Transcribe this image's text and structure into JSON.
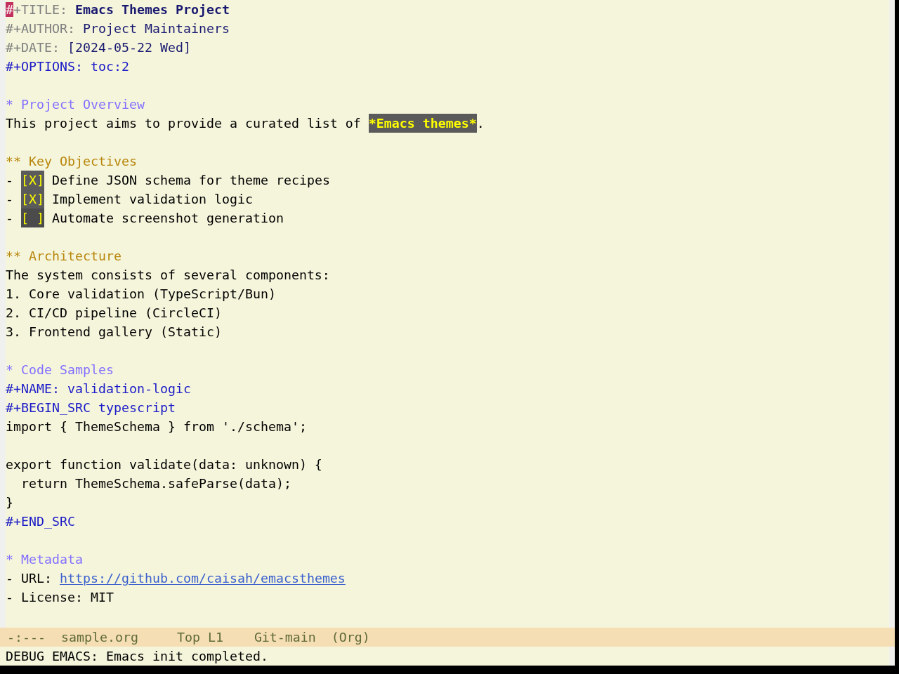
{
  "buffer": {
    "blocks": [
      {
        "lines": [
          {
            "segments": [
              {
                "kind": "cursor",
                "text": "#"
              },
              {
                "kind": "meta",
                "text": "+TITLE: "
              },
              {
                "kind": "title",
                "text": "Emacs Themes Project"
              }
            ]
          },
          {
            "segments": [
              {
                "kind": "meta",
                "text": "#+AUTHOR: "
              },
              {
                "kind": "info",
                "text": "Project Maintainers"
              }
            ]
          },
          {
            "segments": [
              {
                "kind": "meta",
                "text": "#+DATE: "
              },
              {
                "kind": "info",
                "text": "[2024-05-22 Wed]"
              }
            ]
          },
          {
            "segments": [
              {
                "kind": "keyword",
                "text": "#+OPTIONS: toc:2"
              }
            ]
          }
        ]
      },
      {
        "lines": [
          {
            "segments": [
              {
                "kind": "outline1",
                "text": "* Project Overview"
              }
            ]
          },
          {
            "segments": [
              {
                "kind": "plain",
                "text": "This project aims to provide a curated list of "
              },
              {
                "kind": "bold",
                "text": "*Emacs themes*"
              },
              {
                "kind": "plain",
                "text": "."
              }
            ]
          }
        ]
      },
      {
        "lines": [
          {
            "segments": [
              {
                "kind": "outline2",
                "text": "** Key Objectives"
              }
            ]
          },
          {
            "segments": [
              {
                "kind": "plain",
                "text": "- "
              },
              {
                "kind": "checkbox",
                "text": "[X]",
                "checked": true
              },
              {
                "kind": "plain",
                "text": " Define JSON schema for theme recipes"
              }
            ]
          },
          {
            "segments": [
              {
                "kind": "plain",
                "text": "- "
              },
              {
                "kind": "checkbox",
                "text": "[X]",
                "checked": true
              },
              {
                "kind": "plain",
                "text": " Implement validation logic"
              }
            ]
          },
          {
            "segments": [
              {
                "kind": "plain",
                "text": "- "
              },
              {
                "kind": "checkbox",
                "text": "[ ]",
                "checked": false
              },
              {
                "kind": "plain",
                "text": " Automate screenshot generation"
              }
            ]
          }
        ]
      },
      {
        "lines": [
          {
            "segments": [
              {
                "kind": "outline2",
                "text": "** Architecture"
              }
            ]
          },
          {
            "segments": [
              {
                "kind": "plain",
                "text": "The system consists of several components:"
              }
            ]
          },
          {
            "segments": [
              {
                "kind": "plain",
                "text": "1. Core validation (TypeScript/Bun)"
              }
            ]
          },
          {
            "segments": [
              {
                "kind": "plain",
                "text": "2. CI/CD pipeline (CircleCI)"
              }
            ]
          },
          {
            "segments": [
              {
                "kind": "plain",
                "text": "3. Frontend gallery (Static)"
              }
            ]
          }
        ]
      },
      {
        "lines": [
          {
            "segments": [
              {
                "kind": "outline1",
                "text": "* Code Samples"
              }
            ]
          },
          {
            "segments": [
              {
                "kind": "keyword",
                "text": "#+NAME: validation-logic"
              }
            ]
          },
          {
            "segments": [
              {
                "kind": "keyword",
                "text": "#+BEGIN_SRC typescript"
              }
            ]
          },
          {
            "segments": [
              {
                "kind": "plain",
                "text": "import { ThemeSchema } from './schema';"
              }
            ]
          }
        ]
      },
      {
        "lines": [
          {
            "segments": [
              {
                "kind": "plain",
                "text": "export function validate(data: unknown) {"
              }
            ]
          },
          {
            "segments": [
              {
                "kind": "plain",
                "text": "  return ThemeSchema.safeParse(data);"
              }
            ]
          },
          {
            "segments": [
              {
                "kind": "plain",
                "text": "}"
              }
            ]
          },
          {
            "segments": [
              {
                "kind": "keyword",
                "text": "#+END_SRC"
              }
            ]
          }
        ]
      },
      {
        "lines": [
          {
            "segments": [
              {
                "kind": "outline1",
                "text": "* Metadata"
              }
            ]
          },
          {
            "segments": [
              {
                "kind": "plain",
                "text": "- URL: "
              },
              {
                "kind": "link",
                "text": "https://github.com/caisah/emacsthemes"
              }
            ]
          },
          {
            "segments": [
              {
                "kind": "plain",
                "text": "- License: MIT"
              }
            ]
          }
        ]
      }
    ]
  },
  "mode_line": {
    "status": "-:---",
    "buffer_name": "sample.org",
    "position": "Top L1",
    "vc_branch": "Git-main",
    "major_mode": "(Org)"
  },
  "echo_area": {
    "message": "DEBUG EMACS: Emacs init completed."
  }
}
